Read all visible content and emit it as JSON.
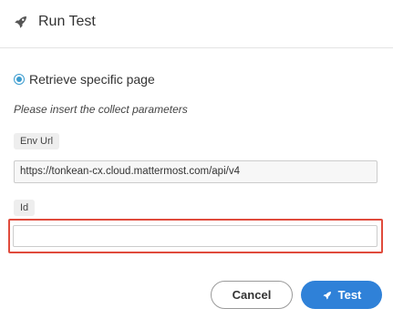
{
  "dialog": {
    "title": "Run Test",
    "icon": "rocket-icon"
  },
  "option": {
    "label": "Retrieve specific page",
    "selected": true
  },
  "instruction": "Please insert the collect parameters",
  "params": [
    {
      "label": "Env Url",
      "value": "https://tonkean-cx.cloud.mattermost.com/api/v4"
    },
    {
      "label": "Id",
      "value": ""
    }
  ],
  "buttons": {
    "cancel": "Cancel",
    "test": "Test"
  },
  "colors": {
    "accent": "#2f81d8",
    "radio": "#3b9ccf",
    "highlight": "#e04b3c"
  }
}
